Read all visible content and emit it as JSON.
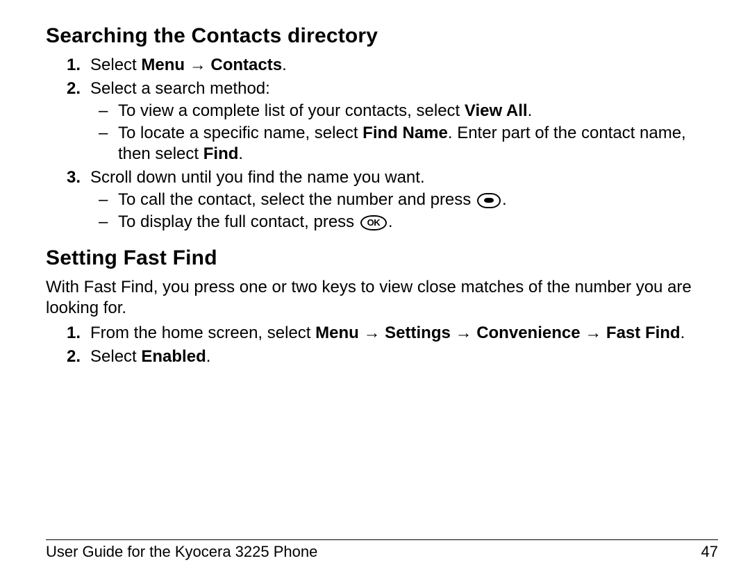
{
  "section1": {
    "heading": "Searching the Contacts directory",
    "steps": {
      "s1_pre": "Select ",
      "s1_b1": "Menu",
      "s1_arr": " → ",
      "s1_b2": "Contacts",
      "s1_post": ".",
      "s2": "Select a search method:",
      "s2a_pre": "To view a complete list of your contacts, select ",
      "s2a_b1": "View All",
      "s2a_post": ".",
      "s2b_pre": "To locate a specific name, select ",
      "s2b_b1": "Find Name",
      "s2b_mid": ". Enter part of the contact name, then select ",
      "s2b_b2": "Find",
      "s2b_post": ".",
      "s3": "Scroll down until you find the name you want.",
      "s3a": "To call the contact, select the number and press ",
      "s3a_post": ".",
      "s3b": "To display the full contact, press ",
      "s3b_post": "."
    }
  },
  "section2": {
    "heading": "Setting Fast Find",
    "intro": "With Fast Find, you press one or two keys to view close matches of the number you are looking for.",
    "steps": {
      "s1_pre": "From the home screen, select ",
      "s1_b1": "Menu",
      "s1_arr1": " → ",
      "s1_b2": "Settings",
      "s1_arr2": " → ",
      "s1_b3": "Convenience",
      "s1_arr3": " → ",
      "s1_b4": "Fast Find",
      "s1_post": ".",
      "s2_pre": "Select ",
      "s2_b1": "Enabled",
      "s2_post": "."
    }
  },
  "footer": {
    "left": "User Guide for the Kyocera 3225 Phone",
    "right": "47"
  },
  "ok_text": "OK"
}
